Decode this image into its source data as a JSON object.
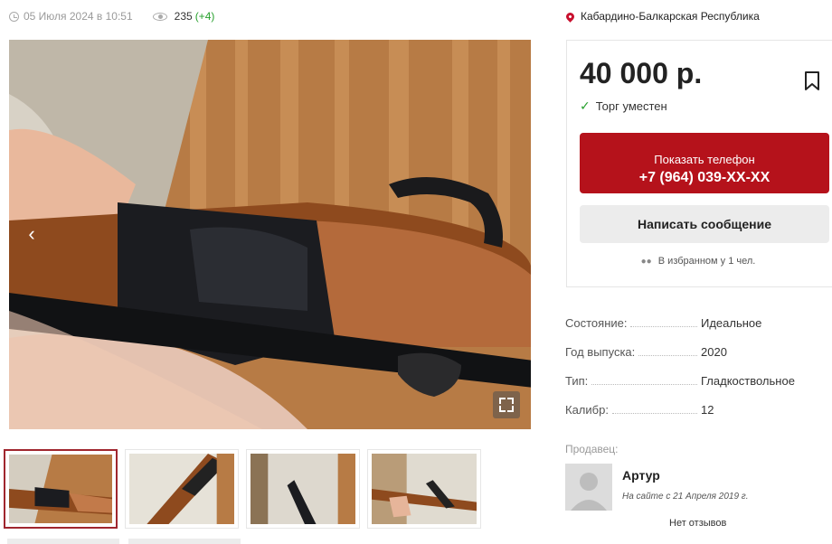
{
  "meta": {
    "date": "05 Июля 2024 в 10:51",
    "views": "235",
    "views_delta": "(+4)"
  },
  "location": "Кабардино-Балкарская Республика",
  "offer": {
    "price": "40 000 р.",
    "bargain": "Торг уместен",
    "phone_label": "Показать телефон",
    "phone_number": "+7 (964) 039-XX-XX",
    "message_label": "Написать сообщение",
    "favorites": "В избранном у 1 чел."
  },
  "specs": [
    {
      "key": "Состояние:",
      "value": "Идеальное"
    },
    {
      "key": "Год выпуска:",
      "value": "2020"
    },
    {
      "key": "Тип:",
      "value": "Гладкоствольное"
    },
    {
      "key": "Калибр:",
      "value": "12"
    }
  ],
  "seller": {
    "label": "Продавец:",
    "name": "Артур",
    "since": "На сайте с 21 Апреля 2019 г.",
    "reviews": "Нет отзывов"
  },
  "colors": {
    "accent": "#b5121b",
    "positive": "#27a02d"
  },
  "icons": [
    "clock-icon",
    "eye-icon",
    "location-pin-icon",
    "bookmark-icon",
    "checkmark-icon",
    "glasses-icon",
    "chevron-left-icon",
    "fullscreen-icon",
    "avatar-placeholder-icon"
  ]
}
